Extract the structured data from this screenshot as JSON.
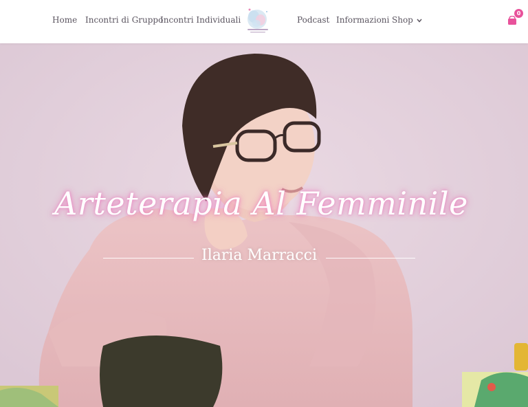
{
  "nav": {
    "items_left": [
      "Home",
      "Incontri di Gruppo",
      "Incontri Individuali"
    ],
    "items_right": [
      "Podcast",
      "Informazioni",
      "Shop"
    ],
    "logo_icon": "watercolor-logo-icon",
    "shop_icon": "chevron-down-icon"
  },
  "cart": {
    "icon": "shopping-bag-icon",
    "count": "0",
    "color": "#e8529b"
  },
  "hero": {
    "title": "Arteterapia Al Femminile",
    "subtitle": "Ilaria Marracci",
    "background_color": "#e4d4de",
    "glow_color": "#f078be"
  }
}
